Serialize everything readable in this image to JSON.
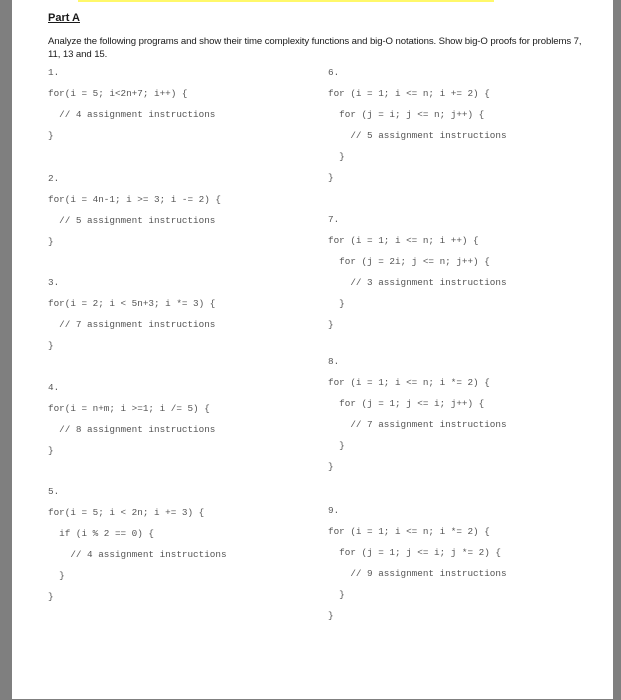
{
  "document": {
    "part_title": "Part A",
    "intro": "Analyze the following programs and show their time complexity functions and big-O notations. Show big-O proofs for problems 7, 11, 13 and 15."
  },
  "problems": [
    {
      "number": "1.",
      "lines": [
        "for(i = 5; i<2n+7; i++) {",
        "  // 4 assignment instructions",
        "}"
      ]
    },
    {
      "number": "2.",
      "lines": [
        "for(i = 4n-1; i >= 3; i -= 2) {",
        "  // 5 assignment instructions",
        "}"
      ]
    },
    {
      "number": "3.",
      "lines": [
        "for(i = 2; i < 5n+3; i *= 3) {",
        "  // 7 assignment instructions",
        "}"
      ]
    },
    {
      "number": "4.",
      "lines": [
        "for(i = n+m; i >=1; i /= 5) {",
        "  // 8 assignment instructions",
        "}"
      ]
    },
    {
      "number": "5.",
      "lines": [
        "for(i = 5; i < 2n; i += 3) {",
        "  if (i % 2 == 0) {",
        "    // 4 assignment instructions",
        "  }",
        "}"
      ]
    },
    {
      "number": "6.",
      "lines": [
        "for (i = 1; i <= n; i += 2) {",
        "  for (j = i; j <= n; j++) {",
        "    // 5 assignment instructions",
        "  }",
        "}"
      ]
    },
    {
      "number": "7.",
      "lines": [
        "for (i = 1; i <= n; i ++) {",
        "  for (j = 2i; j <= n; j++) {",
        "    // 3 assignment instructions",
        "  }",
        "}"
      ]
    },
    {
      "number": "8.",
      "lines": [
        "for (i = 1; i <= n; i *= 2) {",
        "  for (j = 1; j <= i; j++) {",
        "    // 7 assignment instructions",
        "  }",
        "}"
      ]
    },
    {
      "number": "9.",
      "lines": [
        "for (i = 1; i <= n; i *= 2) {",
        "  for (j = 1; j <= i; j *= 2) {",
        "    // 9 assignment instructions",
        "  }",
        "}"
      ]
    }
  ]
}
